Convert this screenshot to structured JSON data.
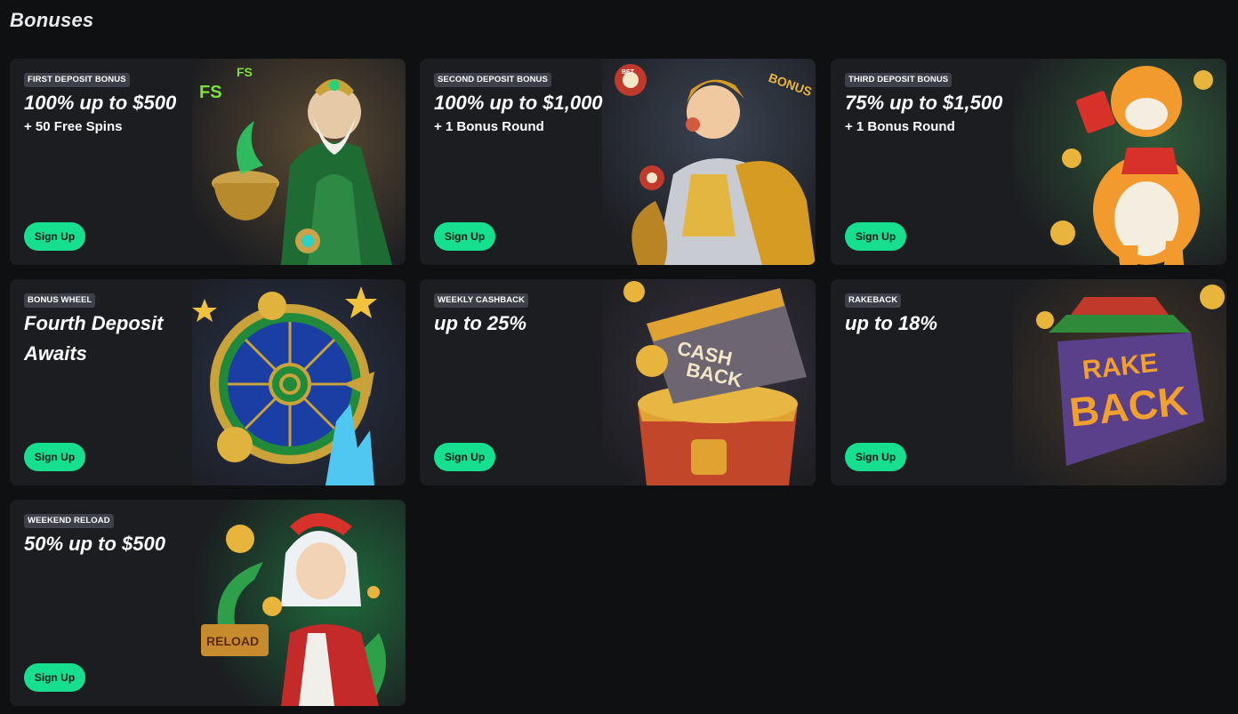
{
  "page": {
    "title": "Bonuses"
  },
  "cards": [
    {
      "tag": "FIRST DEPOSIT BONUS",
      "headline": "100% up to $500",
      "sub": "+ 50 Free Spins",
      "button": "Sign Up",
      "art": "sage-with-cauldron-illustration"
    },
    {
      "tag": "SECOND DEPOSIT BONUS",
      "headline": "100% up to $1,000",
      "sub": "+ 1 Bonus Round",
      "button": "Sign Up",
      "art": "golden-knight-illustration"
    },
    {
      "tag": "THIRD DEPOSIT BONUS",
      "headline": "75% up to $1,500",
      "sub": "+ 1 Bonus Round",
      "button": "Sign Up",
      "art": "fortune-tiger-illustration"
    },
    {
      "tag": "BONUS WHEEL",
      "headline": "Fourth Deposit Awaits",
      "sub": "",
      "button": "Sign Up",
      "art": "bonus-wheel-illustration"
    },
    {
      "tag": "WEEKLY CASHBACK",
      "headline": "up to 25%",
      "sub": "",
      "button": "Sign Up",
      "art": "cashback-chest-illustration"
    },
    {
      "tag": "RAKEBACK",
      "headline": "up to 18%",
      "sub": "",
      "button": "Sign Up",
      "art": "rakeback-logo-illustration"
    },
    {
      "tag": "WEEKEND RELOAD",
      "headline": "50% up to $500",
      "sub": "",
      "button": "Sign Up",
      "art": "reload-girl-illustration"
    }
  ],
  "art_text": {
    "fs1": "FS",
    "fs2": "FS",
    "chip": "BET",
    "bonus": "BONUS",
    "cash": "CASH",
    "back": "BACK",
    "rake": "RAKE",
    "rakeback": "BACK",
    "reload": "RELOAD"
  },
  "colors": {
    "accent": "#16e08f",
    "card_bg": "#1c1d21",
    "page_bg": "#0f1012",
    "tag_bg": "#3d3f49"
  }
}
